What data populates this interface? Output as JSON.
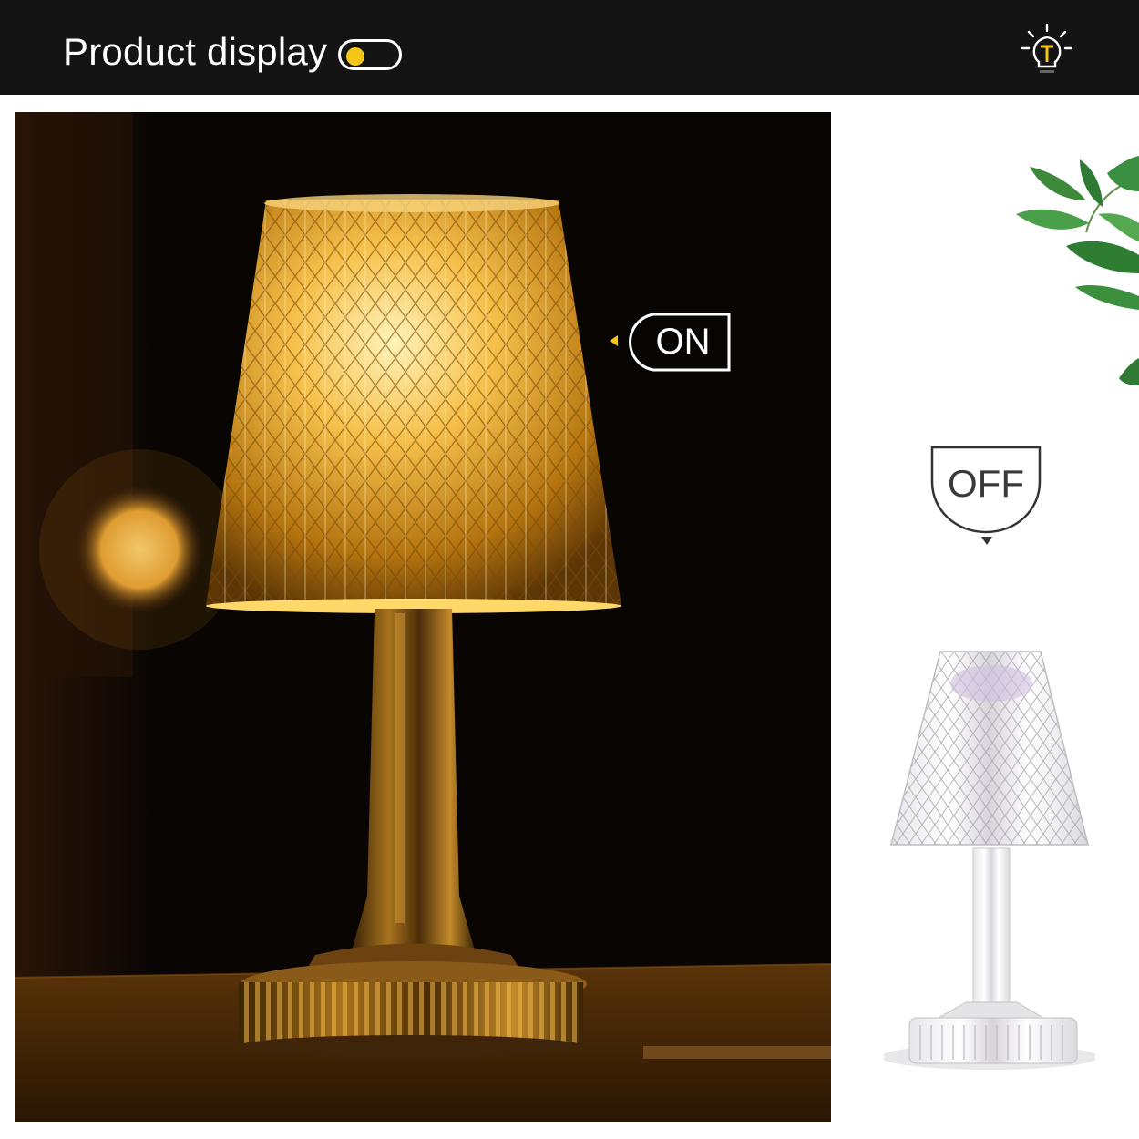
{
  "header": {
    "title": "Product display",
    "toggle_state": "on",
    "accent_color": "#f5c518",
    "icon": "lightbulb-icon"
  },
  "labels": {
    "on": "ON",
    "off": "OFF"
  },
  "images": {
    "lit_lamp": "crystal-lamp-lit-photo",
    "unlit_lamp": "crystal-lamp-unlit-photo",
    "plant": "green-plant-decoration"
  }
}
